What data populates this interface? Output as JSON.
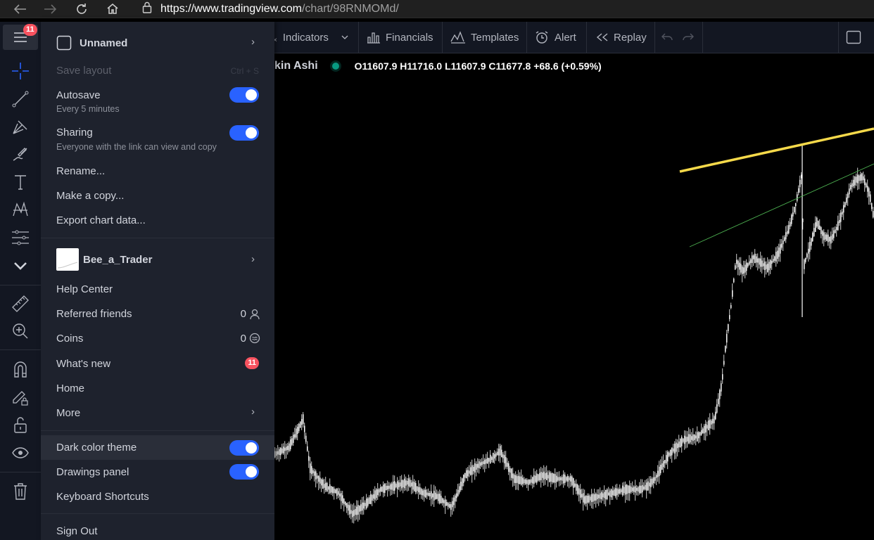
{
  "browser": {
    "url_host": "https://www.tradingview.com",
    "url_path": "/chart/98RNMOMd/"
  },
  "left_toolbar": {
    "menu_badge": "11",
    "tools": [
      "crosshair-icon",
      "trend-line-icon",
      "pitchfork-icon",
      "brush-icon",
      "text-icon",
      "pattern-icon",
      "forecast-icon",
      "chevron-down-icon",
      "ruler-icon",
      "zoom-in-icon",
      "magnet-icon",
      "lock-pencil-icon",
      "unlock-icon",
      "eye-icon",
      "trash-icon"
    ]
  },
  "top_toolbar": {
    "indicators": "Indicators",
    "financials": "Financials",
    "templates": "Templates",
    "alert": "Alert",
    "replay": "Replay"
  },
  "legend": {
    "chart_type_fragment": "kin Ashi",
    "ohlc": "O11607.9  H11716.0  L11607.9  C11677.8  +68.6 (+0.59%)",
    "status_color": "#089981"
  },
  "menu": {
    "chart_name": "Unnamed",
    "save_layout": "Save layout",
    "save_shortcut": "Ctrl + S",
    "autosave": "Autosave",
    "autosave_sub": "Every 5 minutes",
    "autosave_on": true,
    "sharing": "Sharing",
    "sharing_sub": "Everyone with the link can view and copy",
    "sharing_on": true,
    "rename": "Rename...",
    "make_copy": "Make a copy...",
    "export": "Export chart data...",
    "username": "Bee_a_Trader",
    "help_center": "Help Center",
    "referred_friends": "Referred friends",
    "referred_count": "0",
    "coins": "Coins",
    "coins_count": "0",
    "whats_new": "What's new",
    "whats_new_badge": "11",
    "home": "Home",
    "more": "More",
    "dark_theme": "Dark color theme",
    "dark_theme_on": true,
    "drawings_panel": "Drawings panel",
    "drawings_panel_on": true,
    "keyboard_shortcuts": "Keyboard Shortcuts",
    "sign_out": "Sign Out"
  },
  "colors": {
    "accent": "#2962ff",
    "badge": "#f7525f",
    "trendline_main": "#f5d94a",
    "trendline_secondary": "#4caf50",
    "candles": "#ffffff"
  }
}
